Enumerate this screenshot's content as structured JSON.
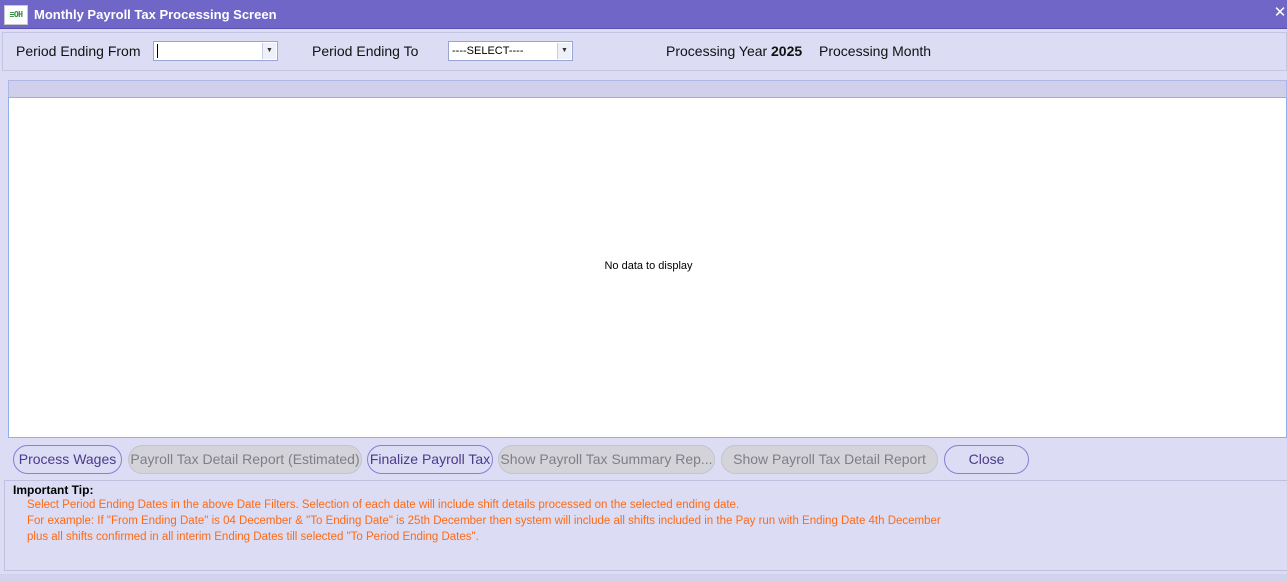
{
  "window": {
    "title": "Monthly Payroll Tax Processing Screen",
    "logo_text": "≡OH",
    "close_glyph": "✕"
  },
  "filters": {
    "period_from_label": "Period Ending From",
    "period_from_value": "",
    "period_to_label": "Period Ending To",
    "period_to_value": "----SELECT----",
    "processing_year_label": "Processing Year",
    "processing_year_value": "2025",
    "processing_month_label": "Processing Month",
    "dropdown_glyph": "▼"
  },
  "grid": {
    "empty_text": "No data to display"
  },
  "buttons": {
    "process_wages": "Process Wages",
    "detail_estimated": "Payroll Tax Detail Report (Estimated)",
    "finalize": "Finalize Payroll Tax",
    "summary_report": "Show  Payroll  Tax  Summary  Rep...",
    "detail_report": "Show Payroll Tax Detail Report",
    "close": "Close"
  },
  "tip": {
    "title": "Important Tip:",
    "line1": "Select Period Ending Dates in the above Date Filters. Selection of each date will include shift details processed on the selected ending date.",
    "line2": "For example: If \"From Ending Date\" is 04 December & \"To Ending Date\" is 25th December then system will include all shifts included in the Pay run with Ending Date 4th December",
    "line3": "plus all shifts confirmed in all interim Ending Dates till selected \"To Period Ending Dates\"."
  },
  "colors": {
    "title_bar": "#7066c8",
    "background": "#dcdcf4",
    "tip_text": "#ff6a13",
    "button_text": "#4a3a8a"
  },
  "icons": {
    "logo": "app-logo-icon",
    "close": "close-icon",
    "dropdown": "chevron-down-icon"
  }
}
